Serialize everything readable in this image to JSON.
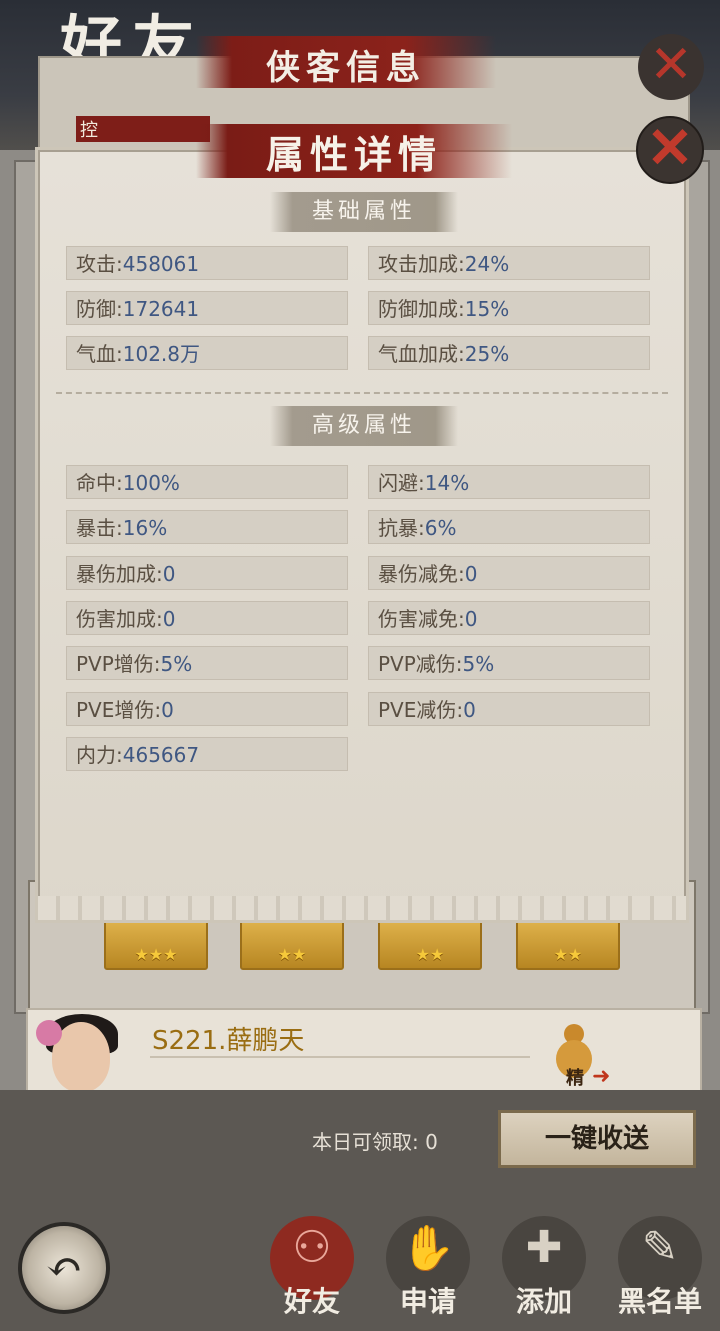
{
  "background": {
    "page_title": "好友",
    "hero_info_title": "侠客信息",
    "tag_text": "控",
    "hero_stars": [
      "★★★",
      "★★",
      "★★",
      "★★"
    ],
    "friend": {
      "name": "S221.薛鹏天",
      "badge": "精"
    },
    "claim_label": "本日可领取: 0",
    "claim_all_button": "一键收送",
    "nav": [
      {
        "label": "好友",
        "glyph": "⚇"
      },
      {
        "label": "申请",
        "glyph": "✋"
      },
      {
        "label": "添加",
        "glyph": "✚"
      },
      {
        "label": "黑名单",
        "glyph": "✎"
      }
    ],
    "back_glyph": "↶",
    "close_glyph": "✕"
  },
  "modal": {
    "title": "属性详情",
    "close_glyph": "✕",
    "basic": {
      "header": "基础属性",
      "left": [
        {
          "label": "攻击:",
          "value": "458061"
        },
        {
          "label": "防御:",
          "value": "172641"
        },
        {
          "label": "气血:",
          "value": "102.8万"
        }
      ],
      "right": [
        {
          "label": "攻击加成:",
          "value": "24%"
        },
        {
          "label": "防御加成:",
          "value": "15%"
        },
        {
          "label": "气血加成:",
          "value": "25%"
        }
      ]
    },
    "advanced": {
      "header": "高级属性",
      "left": [
        {
          "label": "命中:",
          "value": "100%"
        },
        {
          "label": "暴击:",
          "value": "16%"
        },
        {
          "label": "暴伤加成:",
          "value": "0"
        },
        {
          "label": "伤害加成:",
          "value": "0"
        },
        {
          "label": "PVP增伤:",
          "value": "5%"
        },
        {
          "label": "PVE增伤:",
          "value": "0"
        },
        {
          "label": "内力:",
          "value": "465667"
        }
      ],
      "right": [
        {
          "label": "闪避:",
          "value": "14%"
        },
        {
          "label": "抗暴:",
          "value": "6%"
        },
        {
          "label": "暴伤减免:",
          "value": "0"
        },
        {
          "label": "伤害减免:",
          "value": "0"
        },
        {
          "label": "PVP减伤:",
          "value": "5%"
        },
        {
          "label": "PVE减伤:",
          "value": "0"
        }
      ]
    }
  },
  "colors": {
    "banner_red": "#8d2219",
    "value_blue": "#3f5782",
    "label_brown": "#5a4f42",
    "friend_name_gold": "#9a6d12"
  }
}
